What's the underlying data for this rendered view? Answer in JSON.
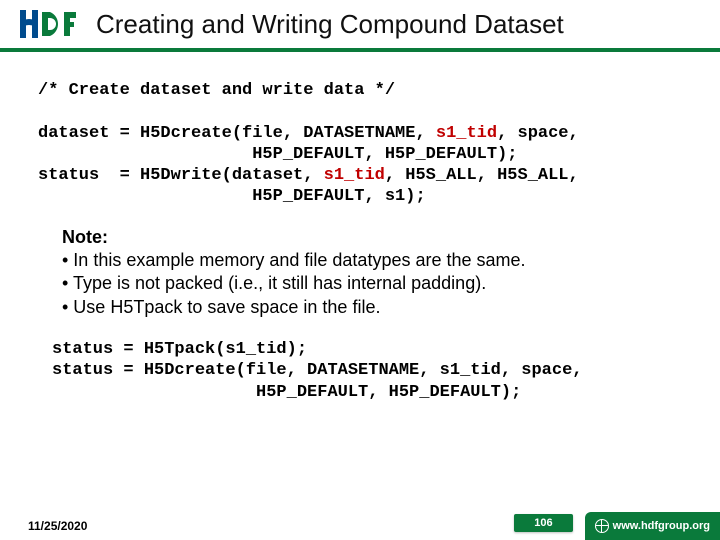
{
  "header": {
    "title": "Creating and Writing Compound Dataset"
  },
  "code_block1": {
    "comment": "/* Create dataset and write data */",
    "line1_a": "dataset = H5Dcreate(file, DATASETNAME, ",
    "line1_red": "s1_tid",
    "line1_b": ", space,",
    "line2": "                     H5P_DEFAULT, H5P_DEFAULT);",
    "line3_a": "status  = H5Dwrite(dataset, ",
    "line3_red": "s1_tid",
    "line3_b": ", H5S_ALL, H5S_ALL,",
    "line4": "                     H5P_DEFAULT, s1);"
  },
  "note": {
    "title": "Note:",
    "b1": "• In this example memory and file datatypes are the same.",
    "b2": "• Type is not packed (i.e., it still has internal padding).",
    "b3": "• Use H5Tpack to save space in the file."
  },
  "code_block2": {
    "line1": "status = H5Tpack(s1_tid);",
    "line2": "status = H5Dcreate(file, DATASETNAME, s1_tid, space,",
    "line3": "                    H5P_DEFAULT, H5P_DEFAULT);"
  },
  "footer": {
    "date": "11/25/2020",
    "page": "106",
    "brand": "www.hdfgroup.org"
  }
}
